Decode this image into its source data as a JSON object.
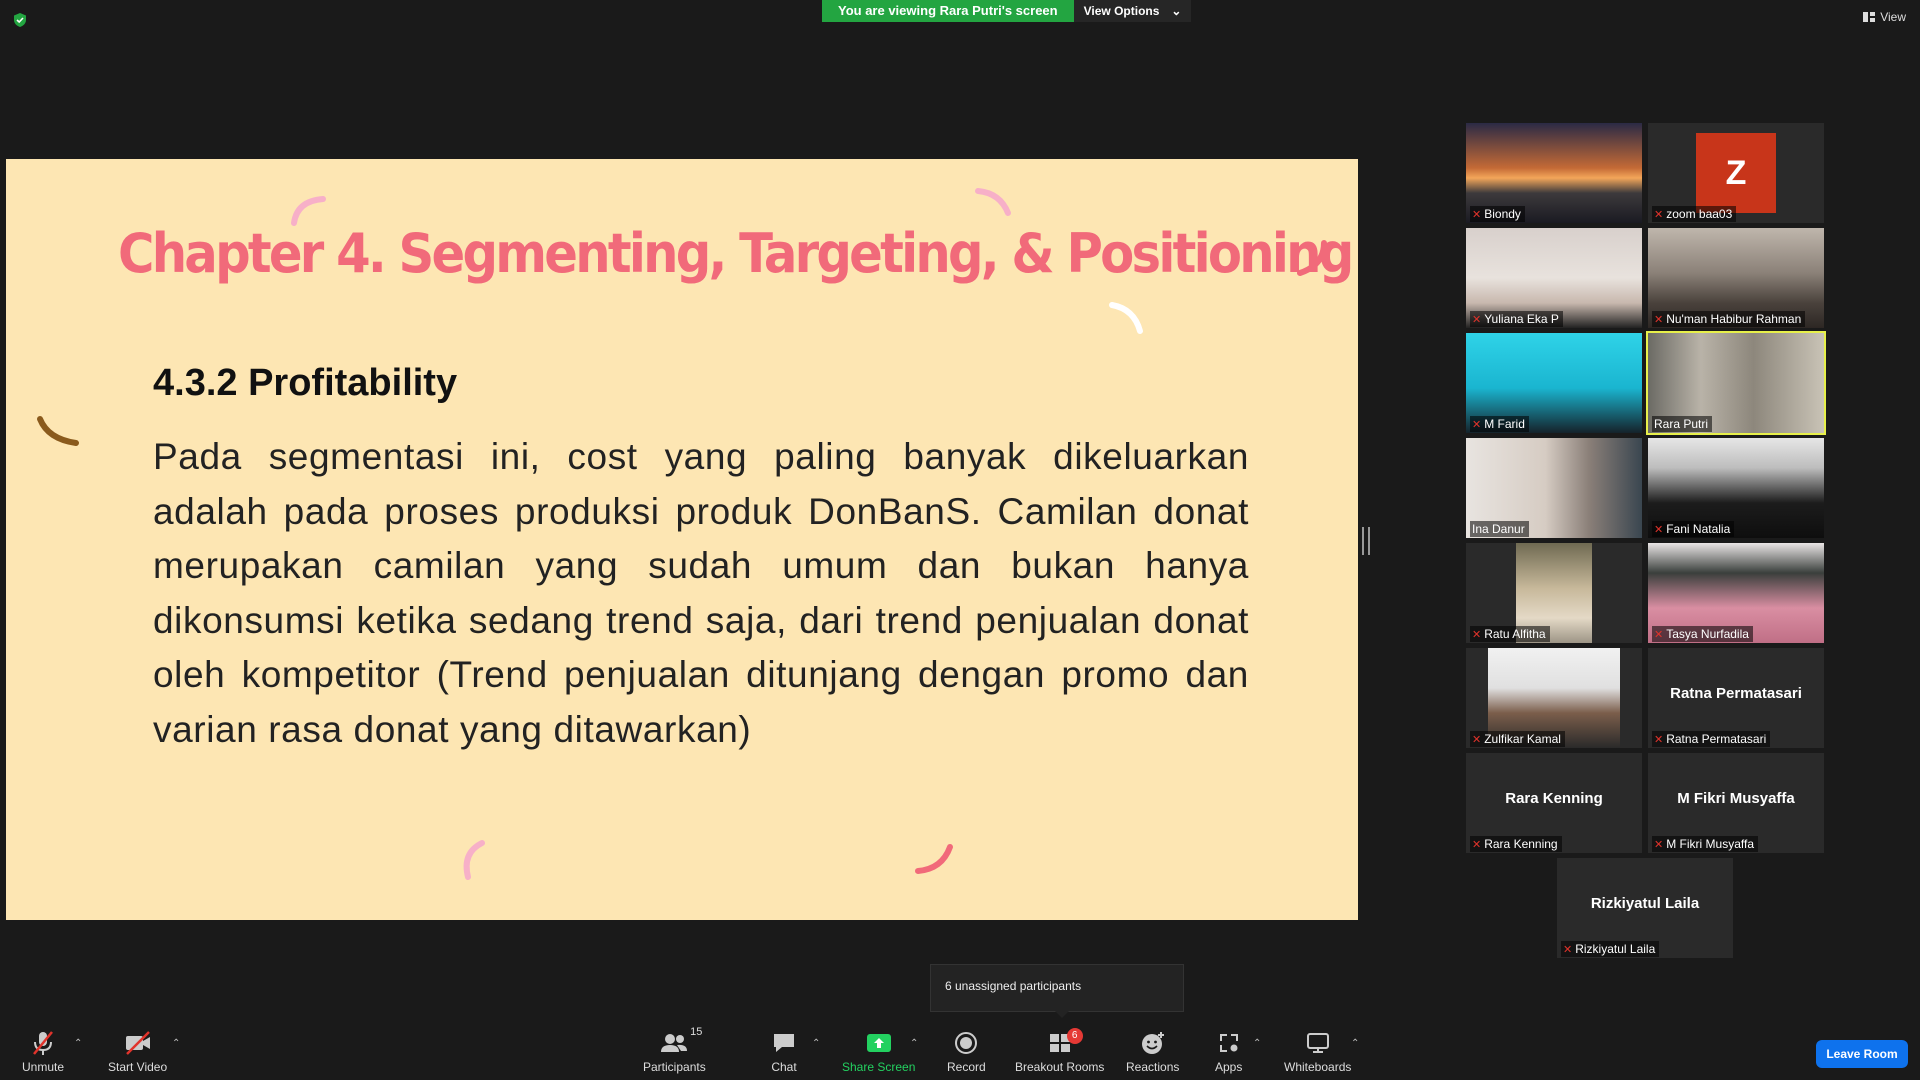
{
  "top_bar": {
    "viewing_banner": "You are viewing Rara Putri's screen",
    "view_options": "View Options",
    "view_button": "View"
  },
  "slide": {
    "title": "Chapter 4. Segmenting, Targeting, & Positioning",
    "subtitle": "4.3.2 Profitability",
    "body": "Pada segmentasi ini, cost yang paling banyak dikeluarkan adalah pada proses produksi produk DonBanS. Camilan donat merupakan camilan yang sudah umum dan bukan hanya dikonsumsi ketika sedang trend saja, dari trend penjualan donat oleh kompetitor (Trend penjualan ditunjang dengan promo dan varian rasa donat yang ditawarkan)"
  },
  "participants": [
    {
      "name": "Biondy"
    },
    {
      "name": "zoom baa03",
      "avatar_letter": "Z"
    },
    {
      "name": "Yuliana Eka P"
    },
    {
      "name": "Nu'man Habibur Rahman"
    },
    {
      "name": "M Farid"
    },
    {
      "name": "Rara Putri"
    },
    {
      "name": "Ina Danur"
    },
    {
      "name": "Fani Natalia"
    },
    {
      "name": "Ratu Alfitha"
    },
    {
      "name": "Tasya Nurfadila"
    },
    {
      "name": "Zulfikar Kamal"
    },
    {
      "name": "Ratna Permatasari",
      "display": "Ratna Permatasari"
    },
    {
      "name": "Rara Kenning",
      "display": "Rara Kenning"
    },
    {
      "name": "M Fikri Musyaffa",
      "display": "M Fikri Musyaffa"
    },
    {
      "name": "Rizkiyatul Laila",
      "display": "Rizkiyatul Laila"
    }
  ],
  "tooltip": {
    "text": "6 unassigned participants"
  },
  "toolbar": {
    "unmute": "Unmute",
    "start_video": "Start Video",
    "participants": "Participants",
    "participants_count": "15",
    "chat": "Chat",
    "share_screen": "Share Screen",
    "record": "Record",
    "breakout_rooms": "Breakout Rooms",
    "breakout_badge": "6",
    "reactions": "Reactions",
    "apps": "Apps",
    "whiteboards": "Whiteboards",
    "leave": "Leave Room"
  },
  "colors": {
    "banner_green": "#23a541",
    "slide_bg": "#fde6b3",
    "title_pink": "#f16a7a",
    "leave_blue": "#0e72ed",
    "active_outline": "#e7f04a"
  }
}
